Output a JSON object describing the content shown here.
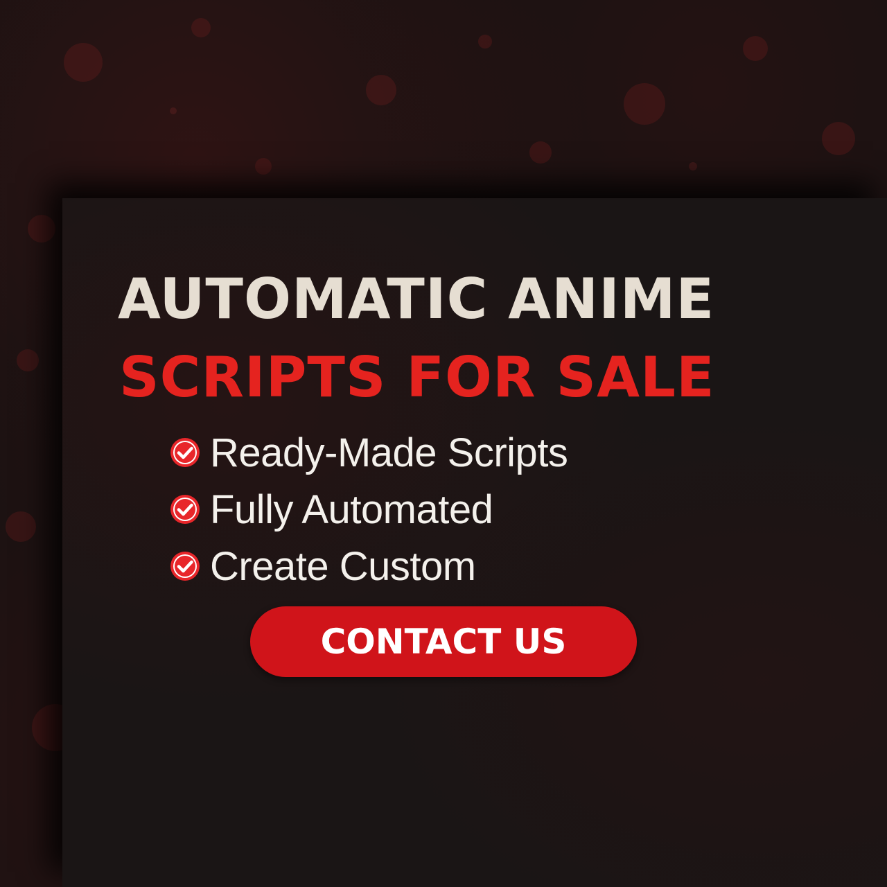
{
  "headline": {
    "line1": "AUTOMATIC ANIME",
    "line2": "SCRIPTS FOR SALE"
  },
  "features": [
    {
      "label": "Ready-Made Scripts",
      "icon": "check-circle-icon"
    },
    {
      "label": "Fully Automated",
      "icon": "check-circle-icon"
    },
    {
      "label": "Create Custom",
      "icon": "check-circle-icon"
    }
  ],
  "cta": {
    "label": "CONTACT US"
  },
  "colors": {
    "background": "#171212",
    "headline_primary": "#e6ded2",
    "headline_accent": "#e5231f",
    "button": "#d0141a",
    "text": "#f4f1ec"
  }
}
